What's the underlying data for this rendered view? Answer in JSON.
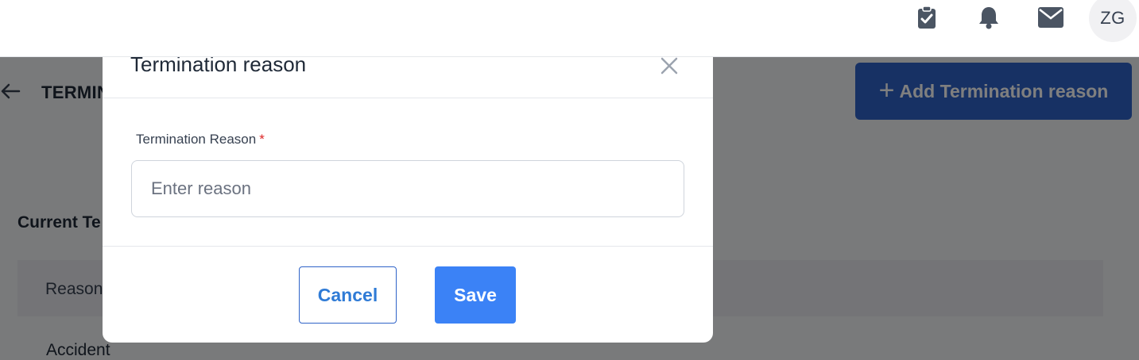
{
  "header": {
    "icons": [
      "clipboard-check-icon",
      "bell-icon",
      "mail-icon"
    ],
    "avatar_initials": "ZG"
  },
  "page": {
    "title": "TERMIN",
    "add_button_label": "Add Termination reason",
    "section_title": "Current Te",
    "table_header": "Reason",
    "first_row": "Accident"
  },
  "modal": {
    "title": "Termination reason",
    "field_label": "Termination Reason",
    "required_mark": "*",
    "input_placeholder": "Enter reason",
    "input_value": "",
    "cancel_label": "Cancel",
    "save_label": "Save"
  },
  "colors": {
    "primary": "#2f63c8",
    "save": "#3b82f6",
    "required": "#dc2626",
    "overlay": "rgba(0,0,0,0.5)"
  }
}
